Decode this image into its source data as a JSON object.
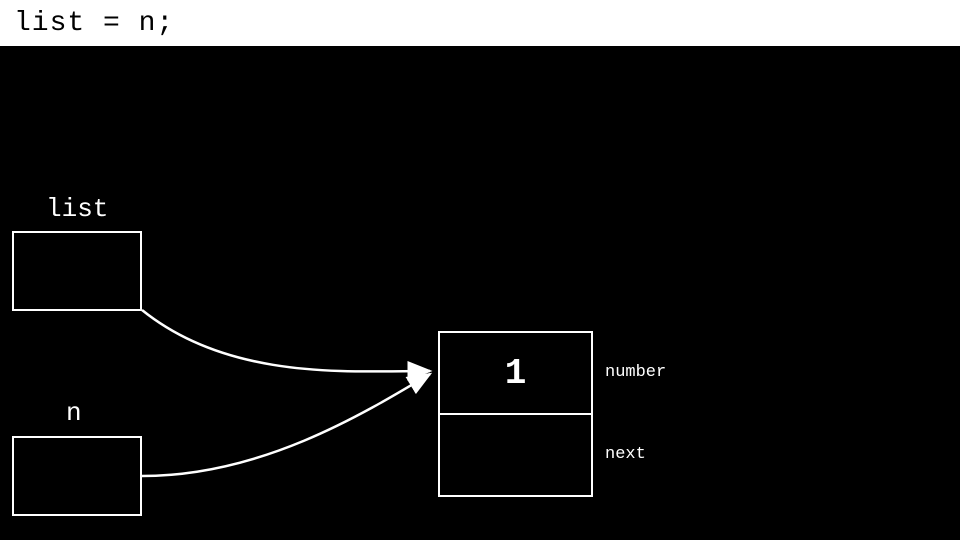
{
  "header": {
    "code": "list = n;"
  },
  "pointers": {
    "list": {
      "label": "list"
    },
    "n": {
      "label": "n"
    }
  },
  "node": {
    "value": "1",
    "field_number_label": "number",
    "field_next_label": "next"
  }
}
